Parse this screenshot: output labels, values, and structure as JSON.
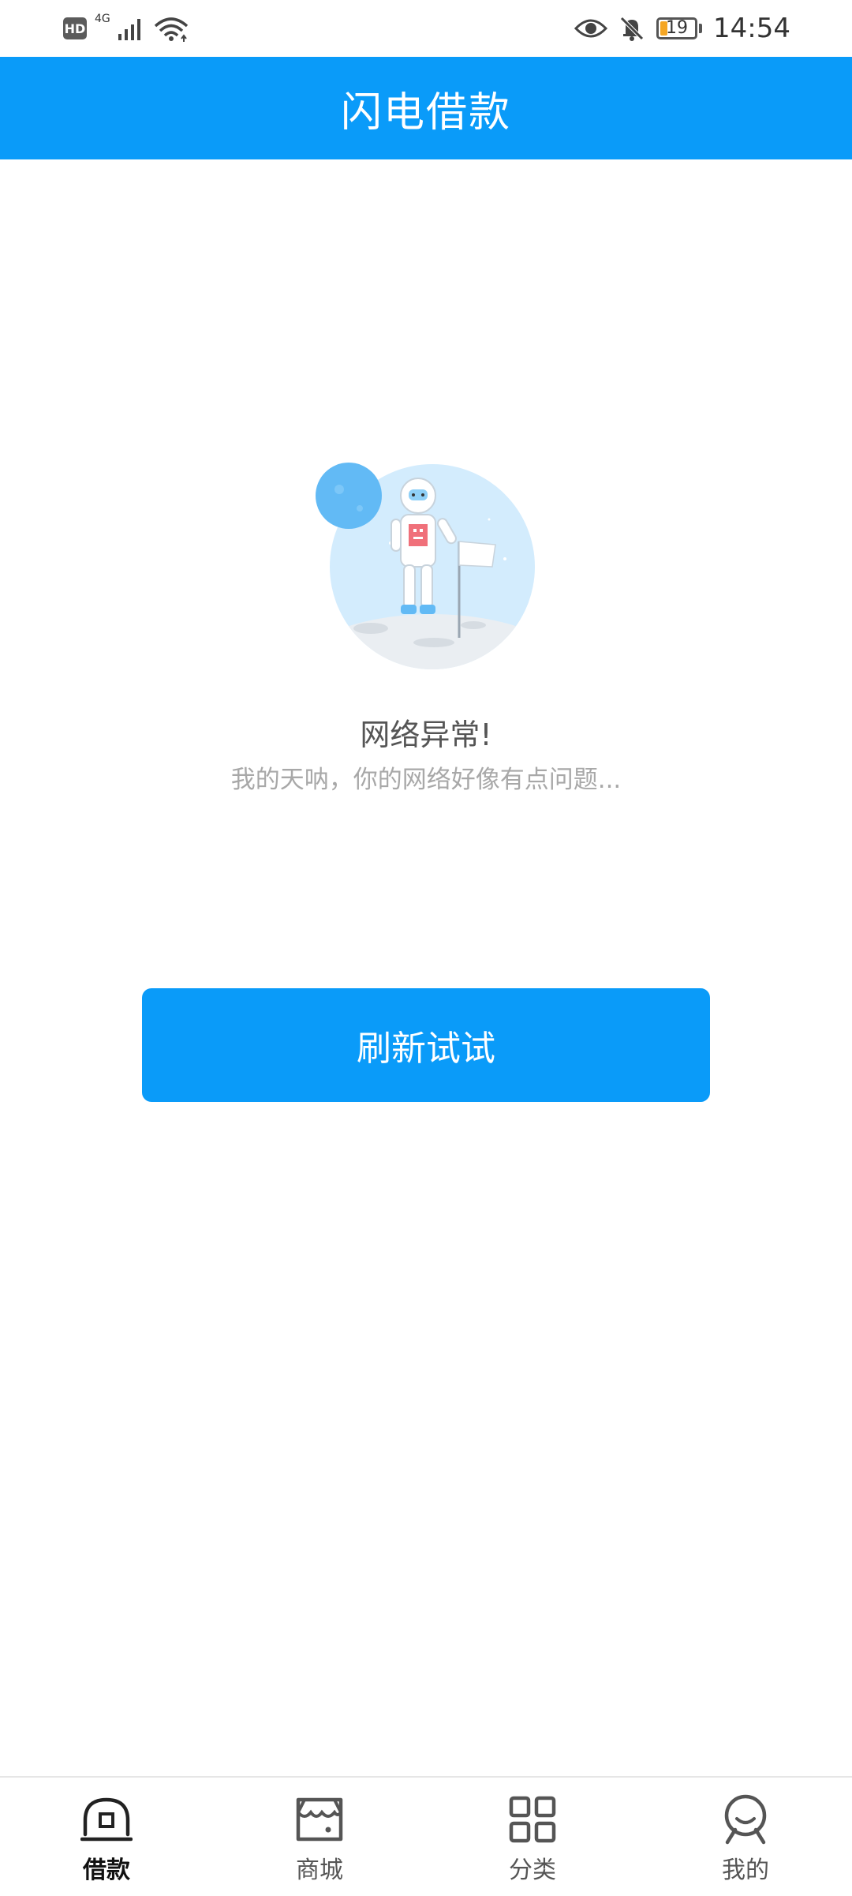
{
  "status_bar": {
    "badge": "HD",
    "network": "4G",
    "battery_level": "19",
    "time": "14:54",
    "icons": [
      "signal-icon",
      "wifi-icon",
      "eye-icon",
      "bell-off-icon",
      "battery-icon"
    ]
  },
  "header": {
    "title": "闪电借款"
  },
  "error": {
    "title": "网络异常!",
    "description": "我的天呐，你的网络好像有点问题..."
  },
  "refresh_button": {
    "label": "刷新试试"
  },
  "colors": {
    "primary": "#0a9bf9",
    "active_tab": "#111111",
    "inactive_tab": "#555555"
  },
  "bottom_nav": {
    "items": [
      {
        "label": "借款",
        "icon": "loan-icon",
        "active": true
      },
      {
        "label": "商城",
        "icon": "store-icon",
        "active": false
      },
      {
        "label": "分类",
        "icon": "grid-icon",
        "active": false
      },
      {
        "label": "我的",
        "icon": "user-icon",
        "active": false
      }
    ]
  }
}
